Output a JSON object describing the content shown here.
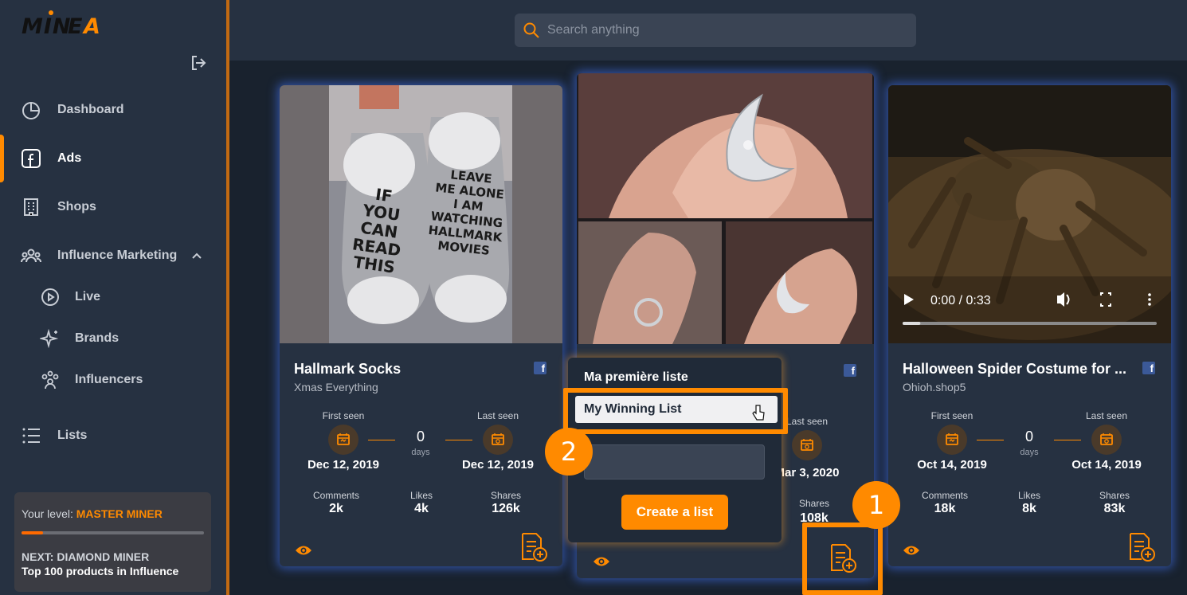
{
  "app": {
    "logo_text": "MINEA"
  },
  "search": {
    "placeholder": "Search anything"
  },
  "nav": {
    "dashboard": "Dashboard",
    "ads": "Ads",
    "shops": "Shops",
    "influence": "Influence Marketing",
    "live": "Live",
    "brands": "Brands",
    "influencers": "Influencers",
    "lists": "Lists"
  },
  "level": {
    "prefix": "Your level: ",
    "name": "MASTER MINER",
    "progress": 0.12,
    "next": "NEXT: DIAMOND MINER",
    "next_desc": "Top 100 products in Influence"
  },
  "cards": [
    {
      "title": "Hallmark Socks",
      "shop": "Xmas Everything",
      "first_seen_label": "First seen",
      "last_seen_label": "Last seen",
      "first_seen": "Dec 12, 2019",
      "last_seen": "Dec 12, 2019",
      "days": "0",
      "days_label": "days",
      "comments_label": "Comments",
      "comments": "2k",
      "likes_label": "Likes",
      "likes": "4k",
      "shares_label": "Shares",
      "shares": "126k",
      "sock_left": [
        "IF",
        "YOU",
        "CAN",
        "READ",
        "THIS"
      ],
      "sock_right": [
        "LEAVE",
        "ME ALONE",
        "I AM",
        "WATCHING",
        "HALLMARK",
        "MOVIES"
      ]
    },
    {
      "last_seen_label": "Last seen",
      "last_seen": "Mar 3, 2020",
      "shares_label": "Shares",
      "shares": "108k"
    },
    {
      "title": "Halloween Spider Costume for ...",
      "shop": "Ohioh.shop5",
      "first_seen_label": "First seen",
      "last_seen_label": "Last seen",
      "first_seen": "Oct 14, 2019",
      "last_seen": "Oct 14, 2019",
      "days": "0",
      "days_label": "days",
      "comments_label": "Comments",
      "comments": "18k",
      "likes_label": "Likes",
      "likes": "8k",
      "shares_label": "Shares",
      "shares": "83k",
      "video_time": "0:00 / 0:33",
      "video_progress": 0.07
    }
  ],
  "popover": {
    "title": "Ma première liste",
    "item": "My Winning List",
    "input_value": "",
    "create_label": "Create a list"
  },
  "steps": {
    "one": "1",
    "two": "2"
  },
  "colors": {
    "accent": "#ff8a00",
    "sidebar": "#263141",
    "glow": "#4678ff"
  }
}
